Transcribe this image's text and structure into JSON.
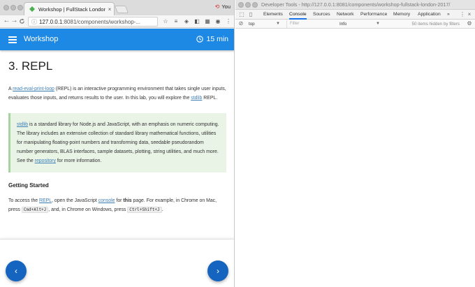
{
  "browser": {
    "tab_title": "Workshop | FullStack London",
    "tab_close": "×",
    "profile_name": "You",
    "back": "←",
    "forward": "→",
    "reload": "C",
    "url_host": "127.0.0.1",
    "url_rest": ":8081/components/workshop-...",
    "star": "☆"
  },
  "appbar": {
    "title": "Workshop",
    "timer": "15 min",
    "accent": "#1e88e5"
  },
  "content": {
    "heading": "3. REPL",
    "intro": {
      "prefix": "A ",
      "link_repl": "read-eval-print-loop",
      "middle": " (REPL) is an interactive programming environment that takes single user inputs, evaluates those inputs, and returns results to the user. In this lab, you will explore the ",
      "link_stdlib": "stdlib",
      "suffix": " REPL."
    },
    "callout": {
      "link_stdlib": "stdlib",
      "text": " is a standard library for Node.js and JavaScript, with an emphasis on numeric computing. The library includes an extensive collection of standard library mathematical functions, utilities for manipulating floating-point numbers and transforming data, seedable pseudorandom number generators, BLAS interfaces, sample datasets, plotting, string utilities, and much more. See the ",
      "link_repository": "repository",
      "suffix": " for more information."
    },
    "getting_started": "Getting Started",
    "access": {
      "prefix": "To access the ",
      "link_repl": "REPL",
      "middle1": ", open the JavaScript ",
      "link_console": "console",
      "middle2": " for ",
      "bold_this": "this",
      "middle3": " page. For example, in Chrome on Mac, press ",
      "code_mac": "Cmd+Alt+J",
      "middle4": ", and, in Chrome on Windows, press ",
      "code_win": "Ctrl+Shift+J",
      "suffix": "."
    }
  },
  "nav": {
    "prev": "‹",
    "next": "›"
  },
  "devtools": {
    "window_title": "Developer Tools - http://127.0.0.1:8081/components/workshop-fullstack-london-2017/",
    "tabs": [
      "Elements",
      "Console",
      "Sources",
      "Network",
      "Performance",
      "Memory",
      "Application"
    ],
    "active_tab": "Console",
    "more_tabs": "»",
    "context": "top",
    "filter_placeholder": "Filter",
    "level": "Info",
    "hidden_count": "50 items hidden by filters"
  }
}
